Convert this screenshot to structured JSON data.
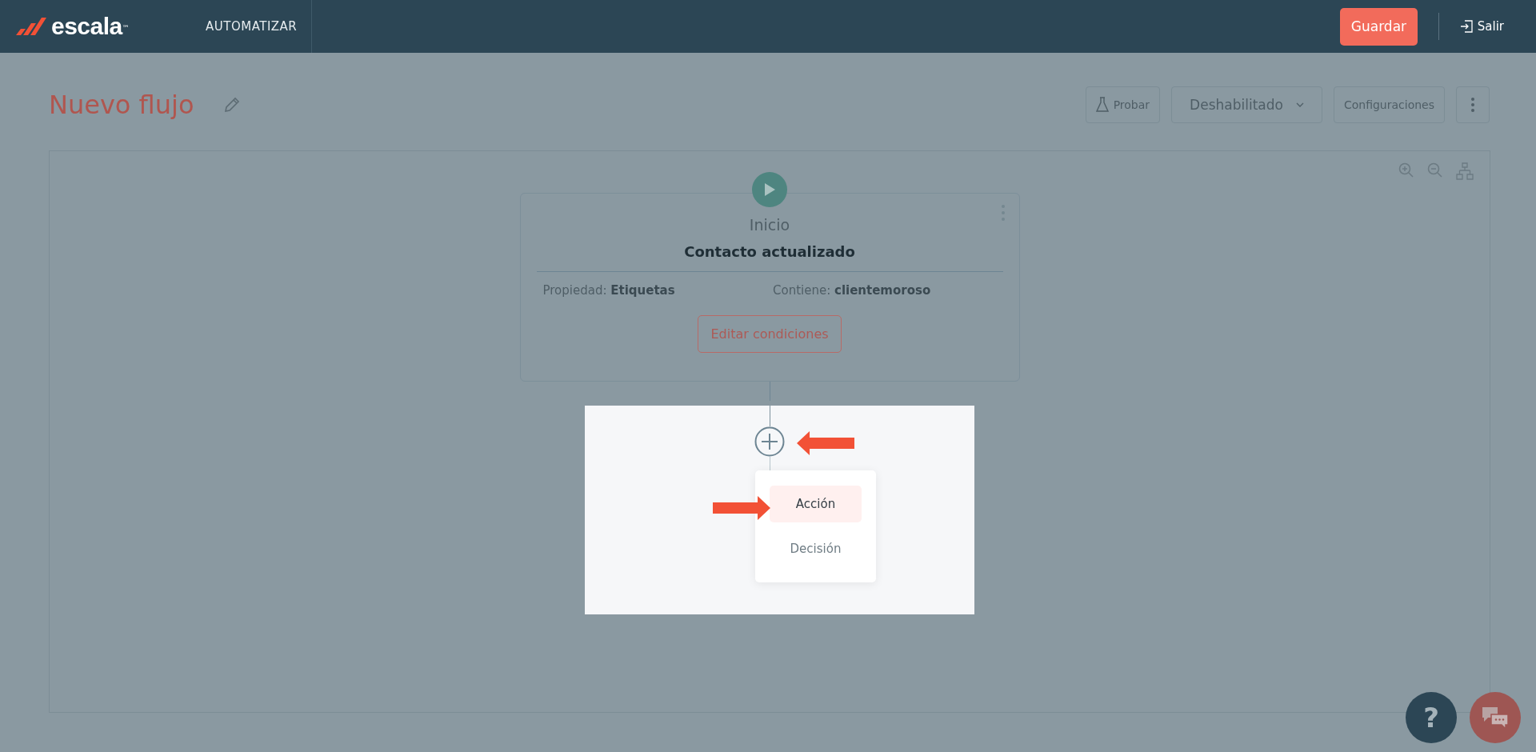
{
  "header": {
    "logo": {
      "text": "escala",
      "mark": "™"
    },
    "nav": "AUTOMATIZAR",
    "save_button": "Guardar",
    "exit_link": "Salir"
  },
  "page": {
    "title": "Nuevo flujo",
    "toolbar": [
      {
        "kind": "test",
        "label": "Probar"
      },
      {
        "kind": "dropdown",
        "label": "Deshabilitado"
      },
      {
        "kind": "plain",
        "label": "Configuraciones"
      },
      {
        "kind": "more"
      }
    ]
  },
  "canvas": {
    "start_node": {
      "label": "Inicio",
      "title": "Contacto actualizado",
      "conditions": [
        "Propiedad: **Etiquetas**",
        "Contiene: **clientemoroso**"
      ],
      "button": "Editar condiciones"
    },
    "add_menu": {
      "items": [
        {
          "label": "Acción",
          "selected": true
        },
        {
          "label": "Decisión",
          "selected": false
        }
      ]
    }
  },
  "help_button": "?"
}
